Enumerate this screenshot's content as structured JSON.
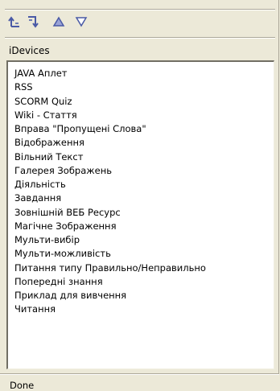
{
  "toolbar": {
    "buttons": [
      {
        "icon": "move-up-level-icon"
      },
      {
        "icon": "move-down-level-icon"
      },
      {
        "icon": "arrow-up-icon"
      },
      {
        "icon": "arrow-down-icon"
      }
    ],
    "icon_color": "#4a5aa6"
  },
  "panel": {
    "title": "iDevices"
  },
  "idevices": [
    "JAVA Аплет",
    "RSS",
    "SCORM Quiz",
    "Wiki - Стаття",
    "Вправа \"Пропущені Слова\"",
    "Відображення",
    "Вільний Текст",
    "Галерея Зображень",
    "Діяльність",
    "Завдання",
    "Зовнішній ВЕБ Ресурс",
    "Магічне Зображення",
    "Мульти-вибір",
    "Мульти-можливість",
    "Питання типу Правильно/Неправильно",
    "Попередні знання",
    "Приклад для вивчення",
    "Читання"
  ],
  "status": {
    "text": "Done"
  }
}
